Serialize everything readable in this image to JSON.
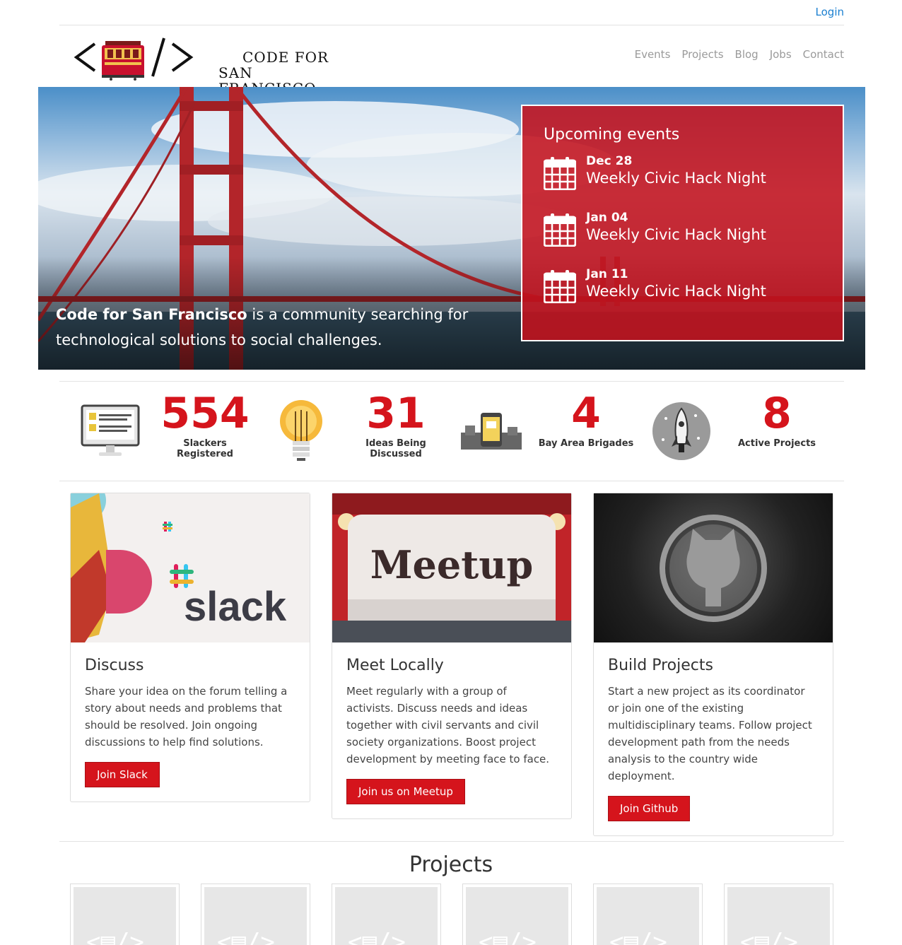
{
  "topbar": {
    "login": "Login"
  },
  "header": {
    "logo_line1": "CODE FOR",
    "logo_line2": "SAN FRANCISCO",
    "nav": [
      "Events",
      "Projects",
      "Blog",
      "Jobs",
      "Contact"
    ]
  },
  "hero": {
    "tagline_bold": "Code for San Francisco",
    "tagline_rest": " is a community searching for technological solutions to social challenges.",
    "events_title": "Upcoming events",
    "events": [
      {
        "date": "Dec 28",
        "name": "Weekly Civic Hack Night"
      },
      {
        "date": "Jan 04",
        "name": "Weekly Civic Hack Night"
      },
      {
        "date": "Jan 11",
        "name": "Weekly Civic Hack Night"
      }
    ]
  },
  "stats": [
    {
      "value": "554",
      "label": "Slackers Registered",
      "icon": "computer-icon"
    },
    {
      "value": "31",
      "label": "Ideas Being Discussed",
      "icon": "lightbulb-icon"
    },
    {
      "value": "4",
      "label": "Bay Area Brigades",
      "icon": "city-phone-icon"
    },
    {
      "value": "8",
      "label": "Active Projects",
      "icon": "rocket-icon"
    }
  ],
  "cards": [
    {
      "title": "Discuss",
      "text": "Share your idea on the forum telling a story about needs and problems that should be resolved. Join ongoing discussions to help find solutions.",
      "button": "Join Slack",
      "image_text": "slack"
    },
    {
      "title": "Meet Locally",
      "text": "Meet regularly with a group of activists. Discuss needs and ideas together with civil servants and civil society organizations. Boost project development by meeting face to face.",
      "button": "Join us on Meetup",
      "image_text": "Meetup"
    },
    {
      "title": "Build Projects",
      "text": "Start a new project as its coordinator or join one of the existing multidisciplinary teams. Follow project development path from the needs analysis to the country wide deployment.",
      "button": "Join Github",
      "image_text": ""
    }
  ],
  "projects": {
    "title": "Projects",
    "count": 6
  },
  "colors": {
    "accent": "#d5141c",
    "link": "#1a7fd0"
  }
}
